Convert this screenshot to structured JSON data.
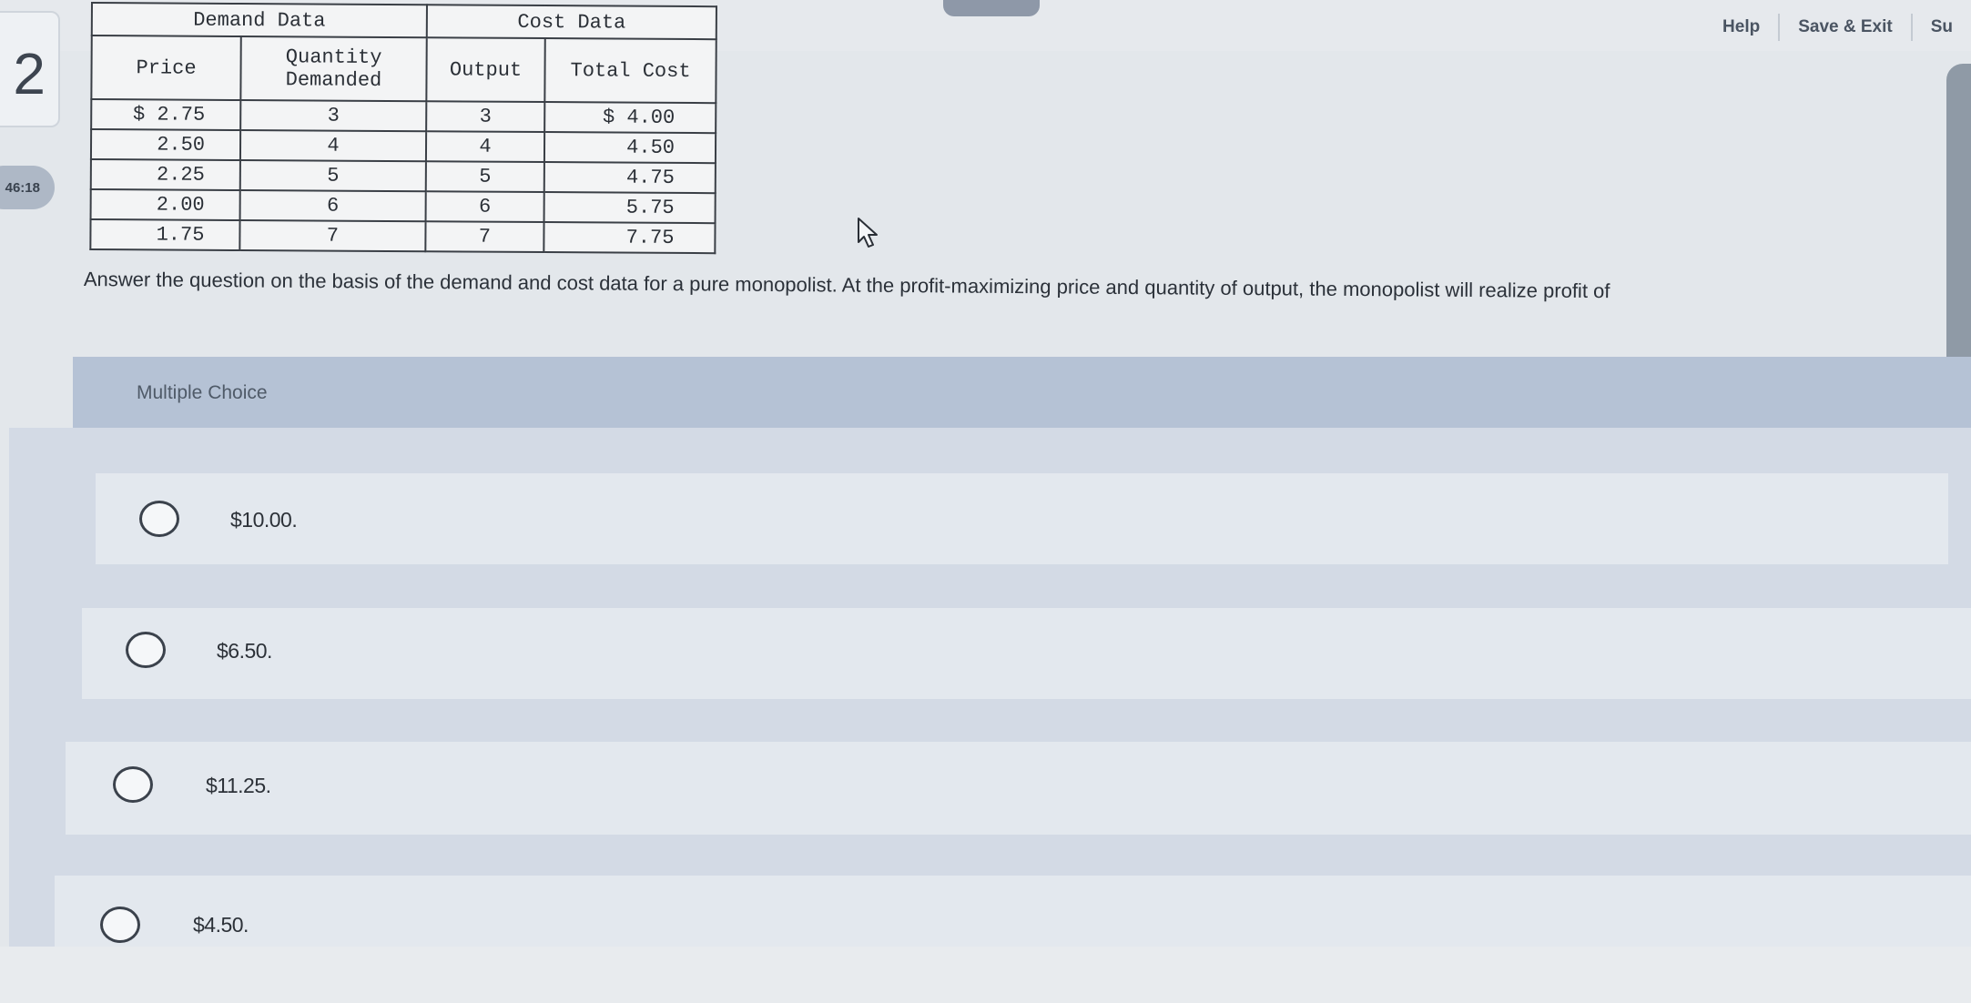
{
  "header": {
    "links": [
      "Help",
      "Save & Exit",
      "Su"
    ]
  },
  "question_number": "2",
  "timer": "46:18",
  "table": {
    "groups": [
      "Demand Data",
      "Cost Data"
    ],
    "columns": [
      "Price",
      "Quantity Demanded",
      "Output",
      "Total Cost"
    ],
    "rows": [
      [
        "$ 2.75",
        "3",
        "3",
        "$ 4.00"
      ],
      [
        "2.50",
        "4",
        "4",
        "4.50"
      ],
      [
        "2.25",
        "5",
        "5",
        "4.75"
      ],
      [
        "2.00",
        "6",
        "6",
        "5.75"
      ],
      [
        "1.75",
        "7",
        "7",
        "7.75"
      ]
    ]
  },
  "question_text": "Answer the question on the basis of the demand and cost data for a pure monopolist. At the profit-maximizing price and quantity of output, the monopolist will realize profit of",
  "multiple_choice": {
    "label": "Multiple Choice",
    "options": [
      "$10.00.",
      "$6.50.",
      "$11.25.",
      "$4.50."
    ]
  }
}
